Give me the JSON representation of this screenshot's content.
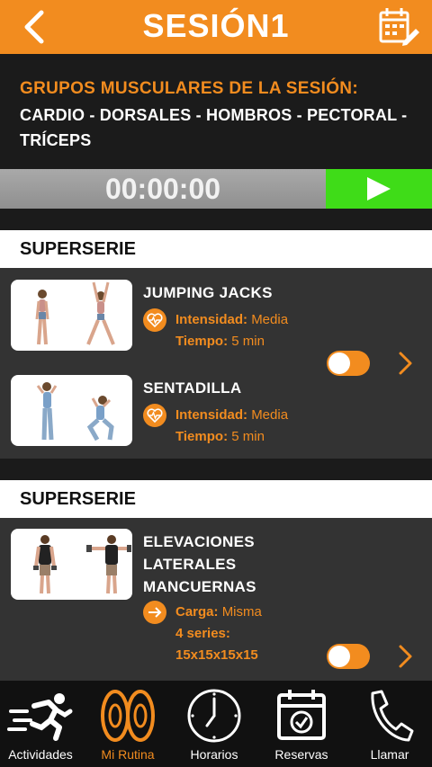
{
  "header": {
    "title": "SESIÓN1",
    "back_icon": "chevron-left-icon",
    "calendar_icon": "calendar-edit-icon"
  },
  "groups": {
    "heading": "GRUPOS MUSCULARES DE LA SESIÓN:",
    "line1": "CARDIO - DORSALES - HOMBROS - PECTORAL -",
    "line2": "TRÍCEPS"
  },
  "timer": {
    "value": "00:00:00",
    "play_icon": "play-icon"
  },
  "sections": [
    {
      "label": "SUPERSERIE",
      "exercises": [
        {
          "name": "JUMPING JACKS",
          "k1": "Intensidad:",
          "v1": "Media",
          "k2": "Tiempo:",
          "v2": "5 min",
          "icon": "heart-pulse-icon"
        },
        {
          "name": "SENTADILLA",
          "k1": "Intensidad:",
          "v1": "Media",
          "k2": "Tiempo:",
          "v2": "5 min",
          "icon": "heart-pulse-icon"
        }
      ]
    },
    {
      "label": "SUPERSERIE",
      "exercises": [
        {
          "name_lines": [
            "ELEVACIONES",
            "LATERALES",
            "MANCUERNAS"
          ],
          "k1": "Carga:",
          "v1": "Misma",
          "k2": "4 series:",
          "v2": "15x15x15x15",
          "icon": "arrow-right-icon"
        }
      ]
    }
  ],
  "tabs": [
    {
      "label": "Actividades",
      "icon": "running-icon",
      "active": false
    },
    {
      "label": "Mi Rutina",
      "icon": "weight-plates-icon",
      "active": true
    },
    {
      "label": "Horarios",
      "icon": "clock-icon",
      "active": false
    },
    {
      "label": "Reservas",
      "icon": "calendar-check-icon",
      "active": false
    },
    {
      "label": "Llamar",
      "icon": "phone-icon",
      "active": false
    }
  ],
  "colors": {
    "accent": "#f28c1f",
    "play": "#3fdc18",
    "card": "#333333",
    "dark": "#1b1b1b"
  }
}
